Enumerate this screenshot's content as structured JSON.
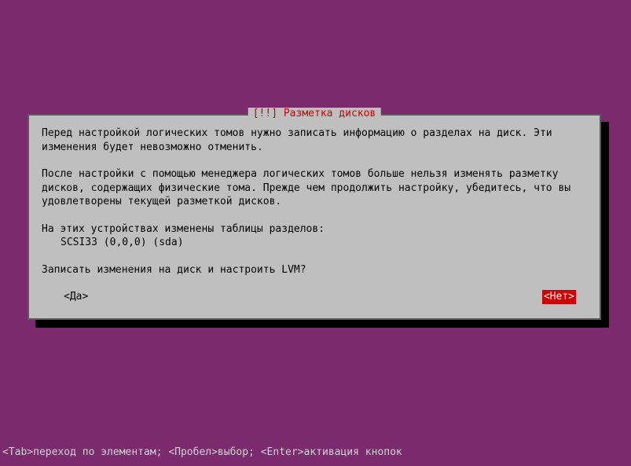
{
  "dialog": {
    "title": "[!!] Разметка дисков",
    "paragraph1": "Перед настройкой логических томов нужно записать информацию о разделах на диск. Эти изменения будет невозможно отменить.",
    "paragraph2": "После настройки с помощью менеджера логических томов больше нельзя изменять разметку дисков, содержащих физические тома. Прежде чем продолжить настройку, убедитесь, что вы удовлетворены текущей разметкой дисков.",
    "devices_label": "На этих устройствах изменены таблицы разделов:",
    "device_item": "SCSI33 (0,0,0) (sda)",
    "question": "Записать изменения на диск и настроить LVM?",
    "btn_yes": "<Да>",
    "btn_no": "<Нет>"
  },
  "help_bar": "<Tab>переход по элементам; <Пробел>выбор; <Enter>активация кнопок"
}
